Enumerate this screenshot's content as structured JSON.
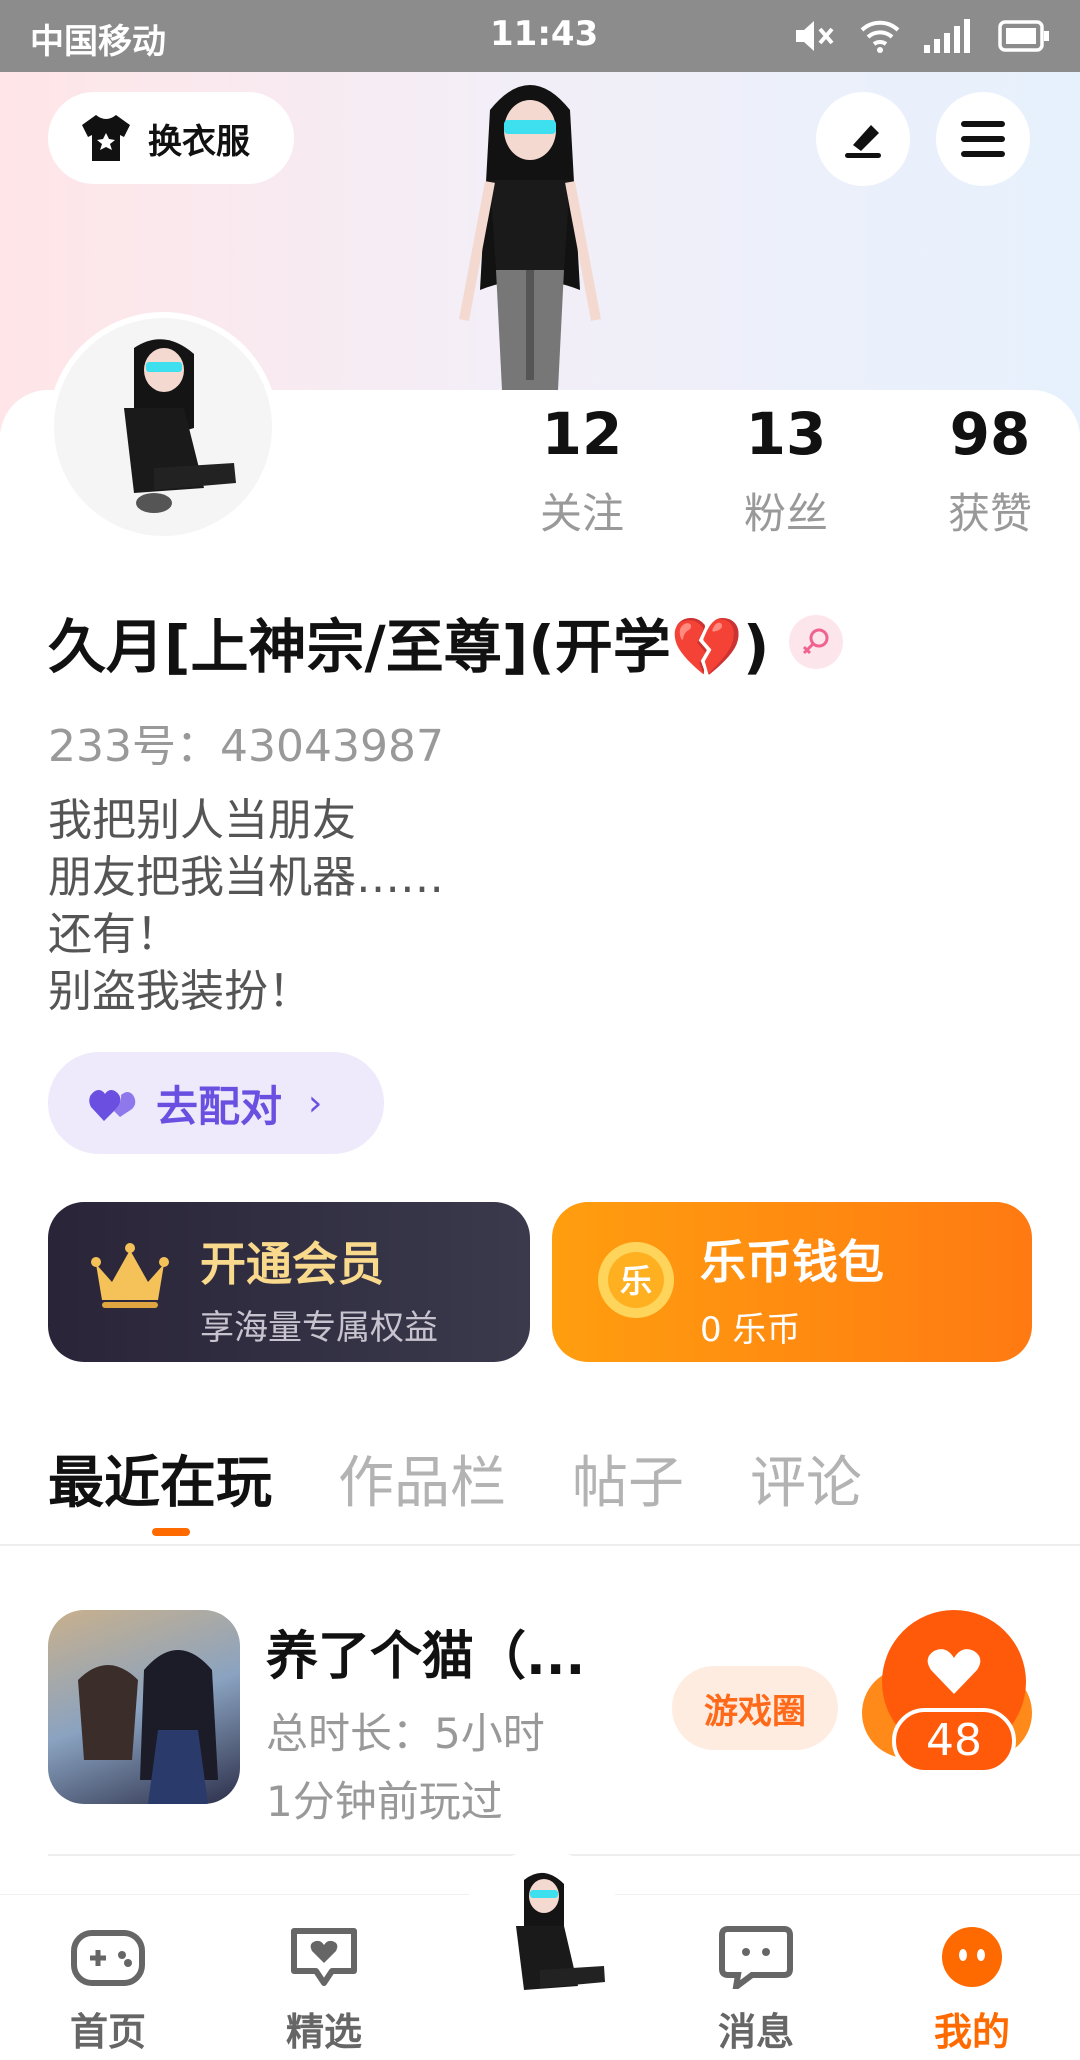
{
  "status_bar": {
    "carrier": "中国移动",
    "time": "11:43"
  },
  "header": {
    "wardrobe_label": "换衣服"
  },
  "stats": [
    {
      "value": "12",
      "label": "关注"
    },
    {
      "value": "13",
      "label": "粉丝"
    },
    {
      "value": "98",
      "label": "获赞"
    }
  ],
  "profile": {
    "username": "久月[上神宗/至尊](开学💔)",
    "account_id": "233号：43043987",
    "bio": [
      "我把别人当朋友",
      "朋友把我当机器……",
      "还有！",
      "别盗我装扮！"
    ],
    "match_label": "去配对"
  },
  "cards": {
    "vip": {
      "title": "开通会员",
      "subtitle": "享海量专属权益"
    },
    "wallet": {
      "title": "乐币钱包",
      "subtitle": "0 乐币",
      "coin_glyph": "乐"
    }
  },
  "tabs": [
    "最近在玩",
    "作品栏",
    "帖子",
    "评论"
  ],
  "recent_games": [
    {
      "title": "养了个猫（...",
      "playtime": "总时长：5小时",
      "last_played": "1分钟前玩过",
      "circle_label": "游戏圈",
      "likes": "48"
    }
  ],
  "bottom_nav": [
    {
      "label": "首页",
      "icon": "gamepad-icon"
    },
    {
      "label": "精选",
      "icon": "heart-chat-icon"
    },
    {
      "label": "消息",
      "icon": "message-icon"
    },
    {
      "label": "我的",
      "icon": "face-icon"
    }
  ],
  "colors": {
    "accent": "#ff6a00",
    "match": "#6a4fe0",
    "vip_gold": "#f9d98c"
  }
}
